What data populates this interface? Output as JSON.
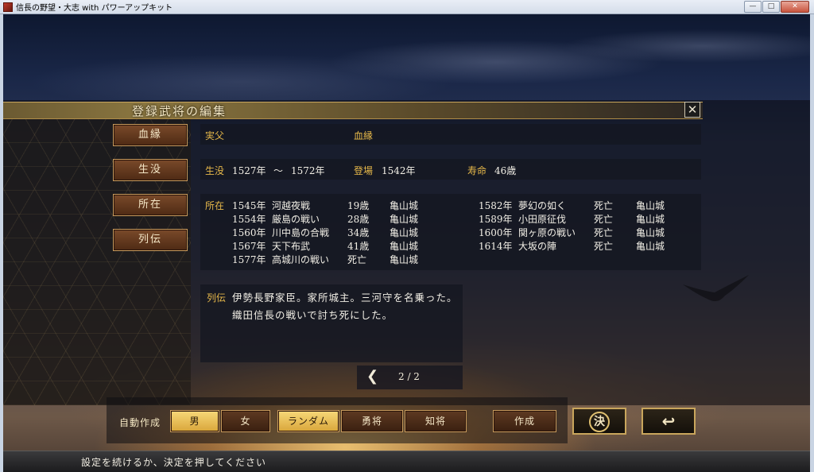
{
  "window": {
    "title": "信長の野望・大志 with パワーアップキット",
    "btn_min": "—",
    "btn_max": "□",
    "btn_close": "✕"
  },
  "panel": {
    "title": "登録武将の編集",
    "close": "✕"
  },
  "nav": [
    "血縁",
    "生没",
    "所在",
    "列伝"
  ],
  "kin": {
    "father_label": "実父",
    "father_value": "",
    "kin_label": "血縁",
    "kin_value": ""
  },
  "life": {
    "label": "生没",
    "birth": "1527年",
    "tilde": "〜",
    "death": "1572年",
    "debut_label": "登場",
    "debut": "1542年",
    "lifespan_label": "寿命",
    "lifespan": "46歳"
  },
  "location": {
    "label": "所在",
    "left": [
      {
        "year": "1545年",
        "event": "河越夜戦",
        "age": "19歳",
        "castle": "亀山城"
      },
      {
        "year": "1554年",
        "event": "厳島の戦い",
        "age": "28歳",
        "castle": "亀山城"
      },
      {
        "year": "1560年",
        "event": "川中島の合戦",
        "age": "34歳",
        "castle": "亀山城"
      },
      {
        "year": "1567年",
        "event": "天下布武",
        "age": "41歳",
        "castle": "亀山城"
      },
      {
        "year": "1577年",
        "event": "高城川の戦い",
        "age": "死亡",
        "castle": "亀山城"
      }
    ],
    "right": [
      {
        "year": "1582年",
        "event": "夢幻の如く",
        "age": "死亡",
        "castle": "亀山城"
      },
      {
        "year": "1589年",
        "event": "小田原征伐",
        "age": "死亡",
        "castle": "亀山城"
      },
      {
        "year": "1600年",
        "event": "関ヶ原の戦い",
        "age": "死亡",
        "castle": "亀山城"
      },
      {
        "year": "1614年",
        "event": "大坂の陣",
        "age": "死亡",
        "castle": "亀山城"
      }
    ]
  },
  "bio": {
    "label": "列伝",
    "text": "伊勢長野家臣。家所城主。三河守を名乗った。織田信長の戦いで討ち死にした。"
  },
  "pager": {
    "prev": "❮",
    "text": "2 / 2"
  },
  "auto": {
    "label": "自動作成",
    "gender": [
      {
        "label": "男",
        "selected": true
      },
      {
        "label": "女",
        "selected": false
      }
    ],
    "type": [
      {
        "label": "ランダム",
        "selected": true
      },
      {
        "label": "勇将",
        "selected": false
      },
      {
        "label": "知将",
        "selected": false
      }
    ],
    "create": "作成"
  },
  "buttons": {
    "decide": "決",
    "back": "↩"
  },
  "status": "設定を続けるか、決定を押してください",
  "colors": {
    "gold": "#e6b84a",
    "selected": "#f7d879",
    "button": "#5e3a22"
  }
}
